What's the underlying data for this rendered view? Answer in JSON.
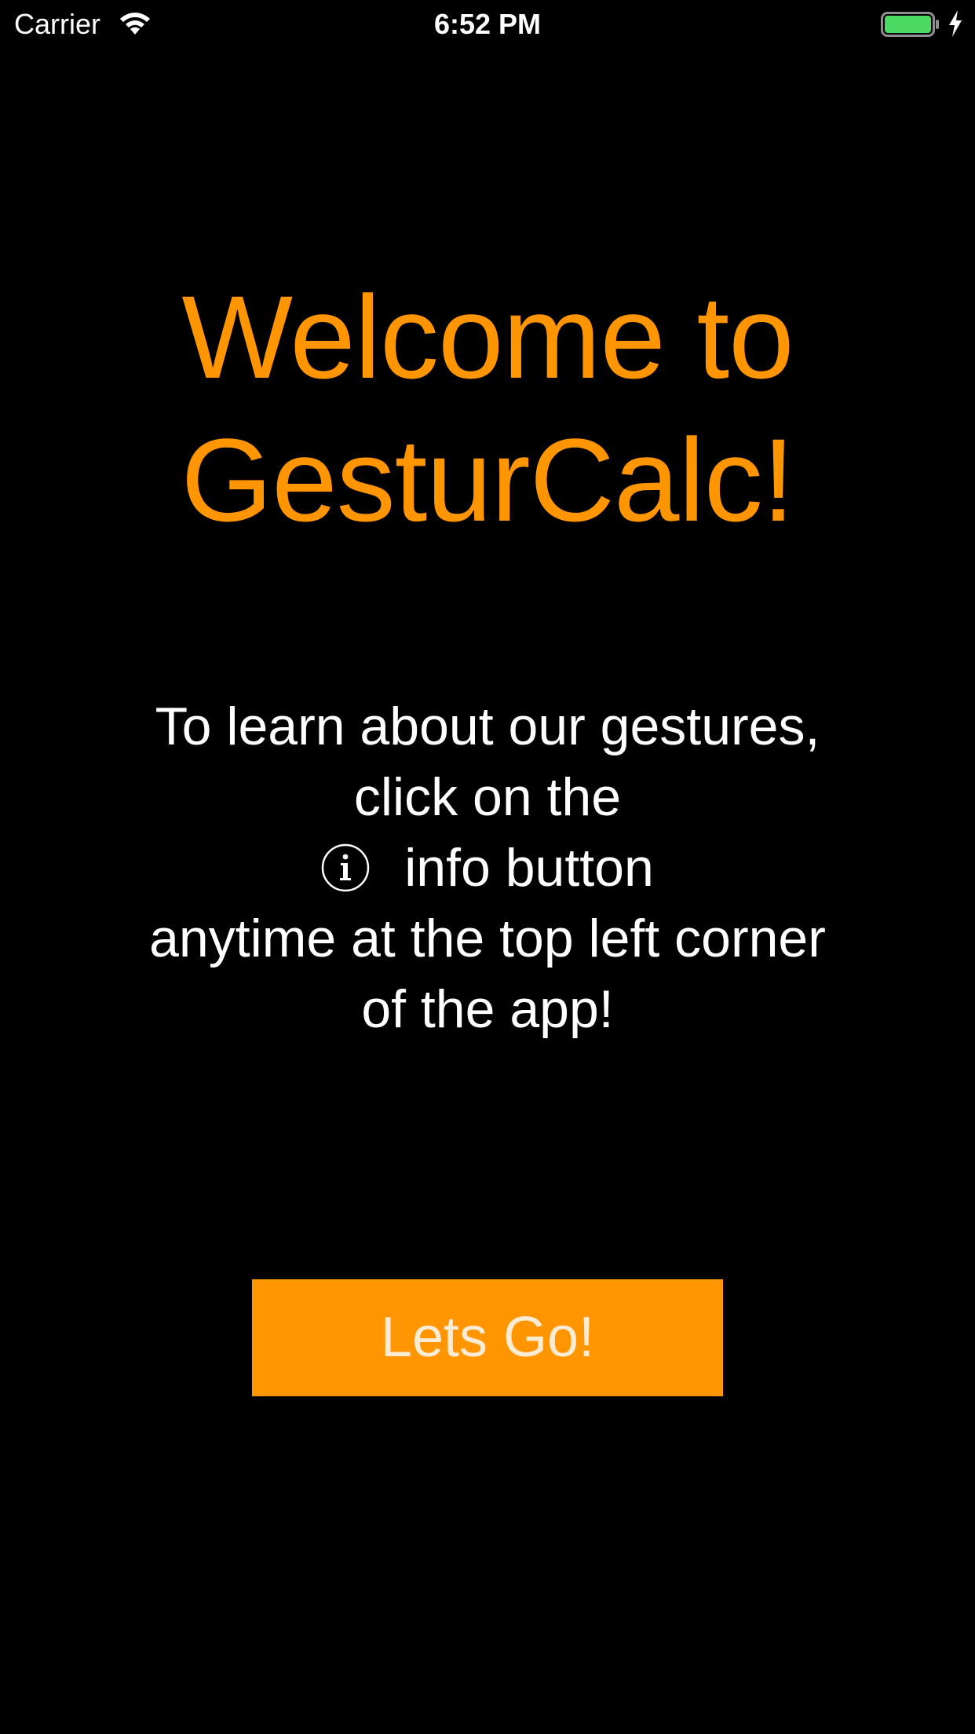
{
  "status_bar": {
    "carrier": "Carrier",
    "time": "6:52 PM",
    "wifi_icon": "wifi-icon",
    "battery_icon": "battery-icon",
    "charging_icon": "charging-bolt-icon",
    "battery_color": "#4cd964",
    "battery_level": 1.0
  },
  "welcome": {
    "line1": "Welcome to",
    "line2": "GesturCalc!",
    "color": "#ff9500"
  },
  "instructions": {
    "line1": "To learn about our gestures,",
    "line2": "click on the",
    "info_icon": "info-circle-icon",
    "line3": "info button",
    "line4": "anytime at the top left corner",
    "line5": "of the app!"
  },
  "button": {
    "label": "Lets Go!",
    "background": "#ff9500"
  }
}
